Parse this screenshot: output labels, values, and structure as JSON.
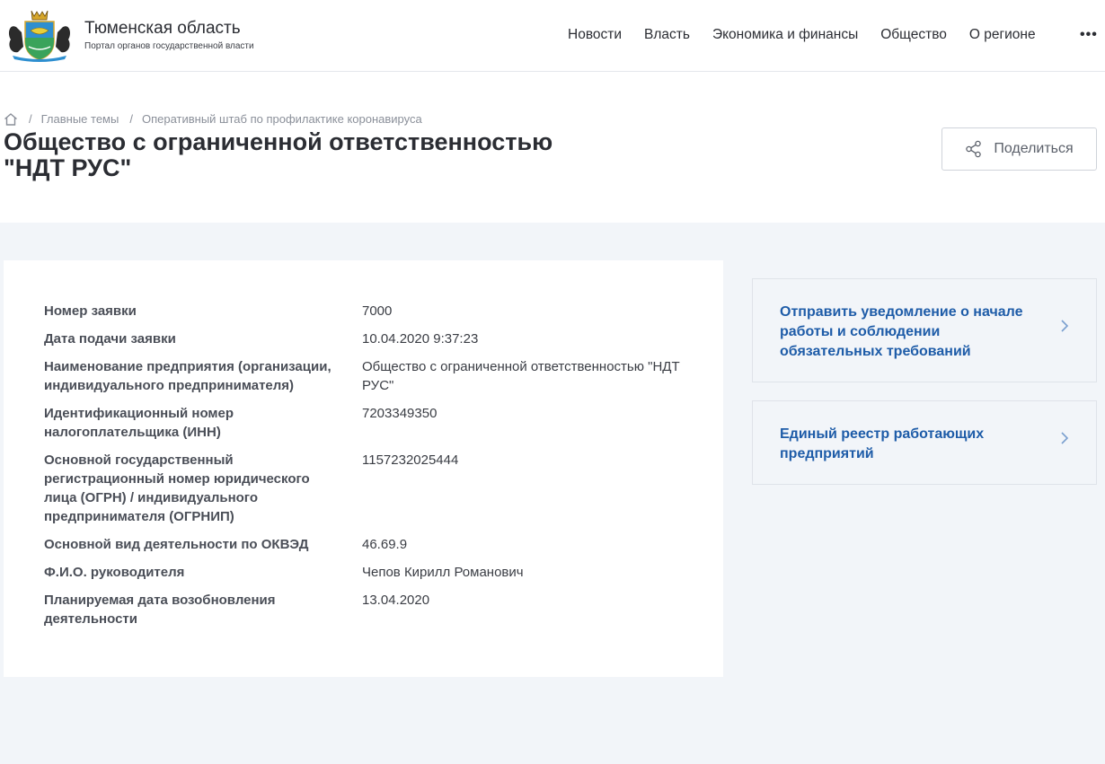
{
  "header": {
    "title": "Тюменская область",
    "subtitle": "Портал органов государственной власти",
    "nav": [
      "Новости",
      "Власть",
      "Экономика и финансы",
      "Общество",
      "О регионе"
    ],
    "more": "•••"
  },
  "breadcrumbs": {
    "items": [
      "Главные темы",
      "Оперативный штаб по профилактике коронавируса"
    ],
    "separator": "/"
  },
  "page": {
    "title_line1": "Общество с ограниченной ответственностью",
    "title_line2": "\"НДТ РУС\"",
    "share_label": "Поделиться"
  },
  "details": [
    {
      "key": "Номер заявки",
      "value": "7000"
    },
    {
      "key": "Дата подачи заявки",
      "value": "10.04.2020 9:37:23"
    },
    {
      "key": "Наименование предприятия (организации, индивидуального предпринимателя)",
      "value": "Общество с ограниченной ответственностью \"НДТ РУС\""
    },
    {
      "key": "Идентификационный номер налогоплательщика (ИНН)",
      "value": "7203349350"
    },
    {
      "key": "Основной государственный регистрационный номер юридического лица (ОГРН) / индивидуального предпринимателя (ОГРНИП)",
      "value": "1157232025444"
    },
    {
      "key": "Основной вид деятельности по ОКВЭД",
      "value": "46.69.9"
    },
    {
      "key": "Ф.И.О. руководителя",
      "value": "Чепов Кирилл Романович"
    },
    {
      "key": "Планируемая дата возобновления деятельности",
      "value": "13.04.2020"
    }
  ],
  "sidebar": {
    "links": [
      "Отправить уведомление о начале работы и соблюдении обязательных требований",
      "Единый реестр работающих предприятий"
    ]
  },
  "colors": {
    "accent": "#1e5ca8",
    "background": "#f2f5f9",
    "text": "#2b2d33"
  },
  "icons": [
    "coat-of-arms-logo",
    "home-icon",
    "share-icon",
    "chevron-right-icon"
  ]
}
